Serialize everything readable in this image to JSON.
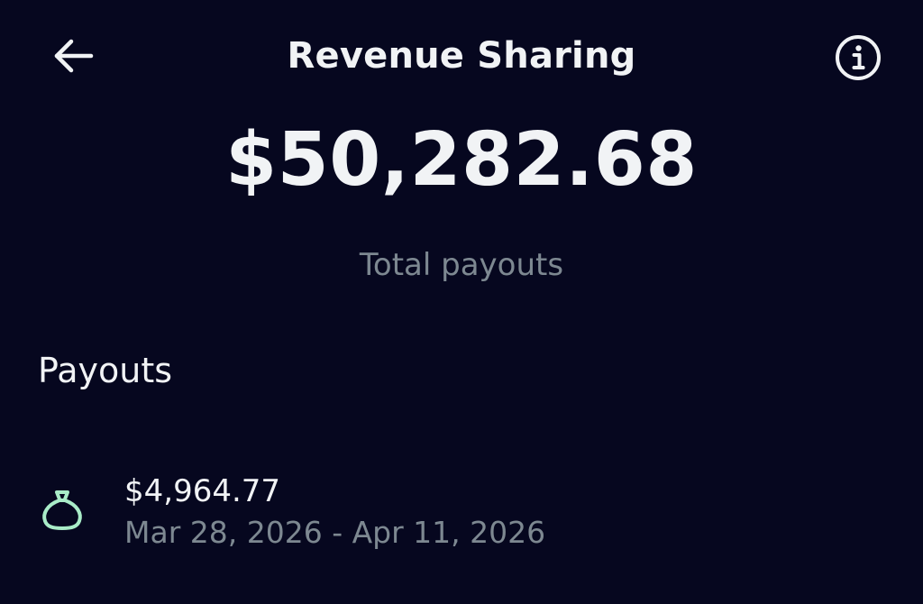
{
  "header": {
    "title": "Revenue Sharing",
    "back_icon": "arrow-left-icon",
    "info_icon": "info-icon"
  },
  "summary": {
    "total_amount": "$50,282.68",
    "total_label": "Total payouts"
  },
  "payouts": {
    "heading": "Payouts",
    "items": [
      {
        "amount": "$4,964.77",
        "range": "Mar 28, 2026 - Apr 11, 2026",
        "icon": "money-bag-icon",
        "icon_color": "#a9ecc8"
      }
    ]
  },
  "colors": {
    "background": "#06071f",
    "primary_text": "#f1f3f5",
    "secondary_text": "#7d8891"
  }
}
